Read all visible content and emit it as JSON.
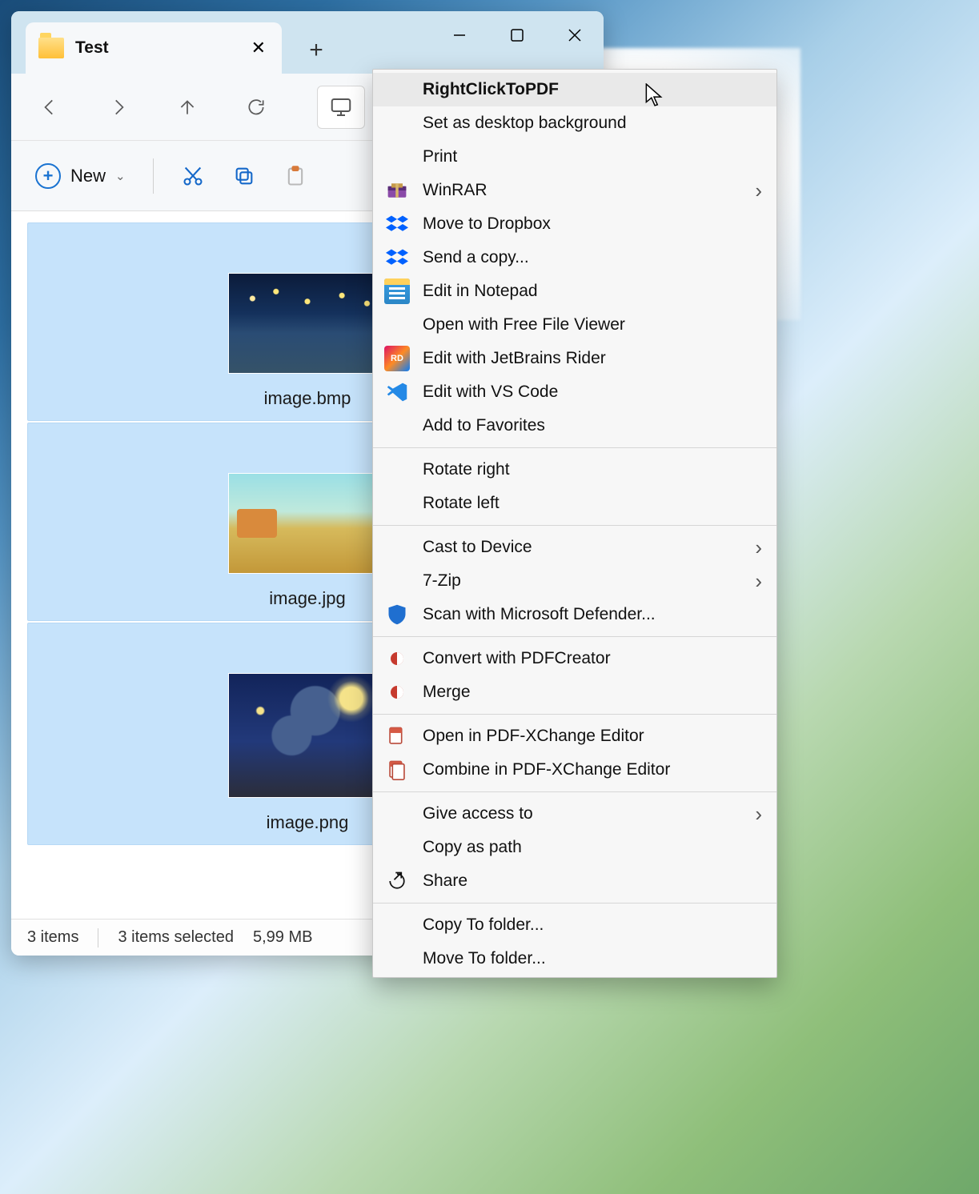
{
  "window": {
    "tab_title": "Test",
    "new_button": "New"
  },
  "files": [
    {
      "name": "image.bmp"
    },
    {
      "name": "image.jpg"
    },
    {
      "name": "image.png"
    }
  ],
  "status": {
    "count": "3 items",
    "selected": "3 items selected",
    "size": "5,99 MB"
  },
  "context_menu": {
    "items": [
      {
        "label": "RightClickToPDF",
        "icon": "",
        "highlight": true
      },
      {
        "label": "Set as desktop background",
        "icon": ""
      },
      {
        "label": "Print",
        "icon": ""
      },
      {
        "label": "WinRAR",
        "icon": "winrar",
        "submenu": true
      },
      {
        "label": "Move to Dropbox",
        "icon": "dropbox"
      },
      {
        "label": "Send a copy...",
        "icon": "dropbox"
      },
      {
        "label": "Edit in Notepad",
        "icon": "notepad"
      },
      {
        "label": "Open with Free File Viewer",
        "icon": ""
      },
      {
        "label": "Edit with JetBrains Rider",
        "icon": "rider"
      },
      {
        "label": "Edit with VS Code",
        "icon": "vscode"
      },
      {
        "label": "Add to Favorites",
        "icon": ""
      },
      {
        "sep": true
      },
      {
        "label": "Rotate right",
        "icon": ""
      },
      {
        "label": "Rotate left",
        "icon": ""
      },
      {
        "sep": true
      },
      {
        "label": "Cast to Device",
        "icon": "",
        "submenu": true
      },
      {
        "label": "7-Zip",
        "icon": "",
        "submenu": true
      },
      {
        "label": "Scan with Microsoft Defender...",
        "icon": "defender"
      },
      {
        "sep": true
      },
      {
        "label": "Convert with PDFCreator",
        "icon": "pdfcreator"
      },
      {
        "label": "Merge",
        "icon": "pdfcreator"
      },
      {
        "sep": true
      },
      {
        "label": "Open in PDF-XChange Editor",
        "icon": "pdfx"
      },
      {
        "label": "Combine in PDF-XChange Editor",
        "icon": "pdfx2"
      },
      {
        "sep": true
      },
      {
        "label": "Give access to",
        "icon": "",
        "submenu": true
      },
      {
        "label": "Copy as path",
        "icon": ""
      },
      {
        "label": "Share",
        "icon": "share"
      },
      {
        "sep": true
      },
      {
        "label": "Copy To folder...",
        "icon": ""
      },
      {
        "label": "Move To folder...",
        "icon": ""
      }
    ]
  },
  "icons": {
    "winrar": {
      "bg": "linear-gradient(#8e3fb7,#6d2e92)",
      "glyph": "📚"
    },
    "dropbox": {
      "bg": "#fff",
      "glyph": "db"
    },
    "notepad": {
      "bg": "linear-gradient(#3aa0e6,#2b86c6)",
      "glyph": "≣"
    },
    "rider": {
      "bg": "linear-gradient(135deg,#dd1265,#7c3bd6)",
      "glyph": "RD"
    },
    "vscode": {
      "bg": "#fff",
      "glyph": "vs"
    },
    "defender": {
      "bg": "#fff",
      "glyph": "🛡"
    },
    "pdfcreator": {
      "bg": "#fff",
      "glyph": "◐"
    },
    "pdfx": {
      "bg": "#fff",
      "glyph": "📄"
    },
    "pdfx2": {
      "bg": "#fff",
      "glyph": "📑"
    },
    "share": {
      "bg": "#fff",
      "glyph": "↗"
    }
  }
}
